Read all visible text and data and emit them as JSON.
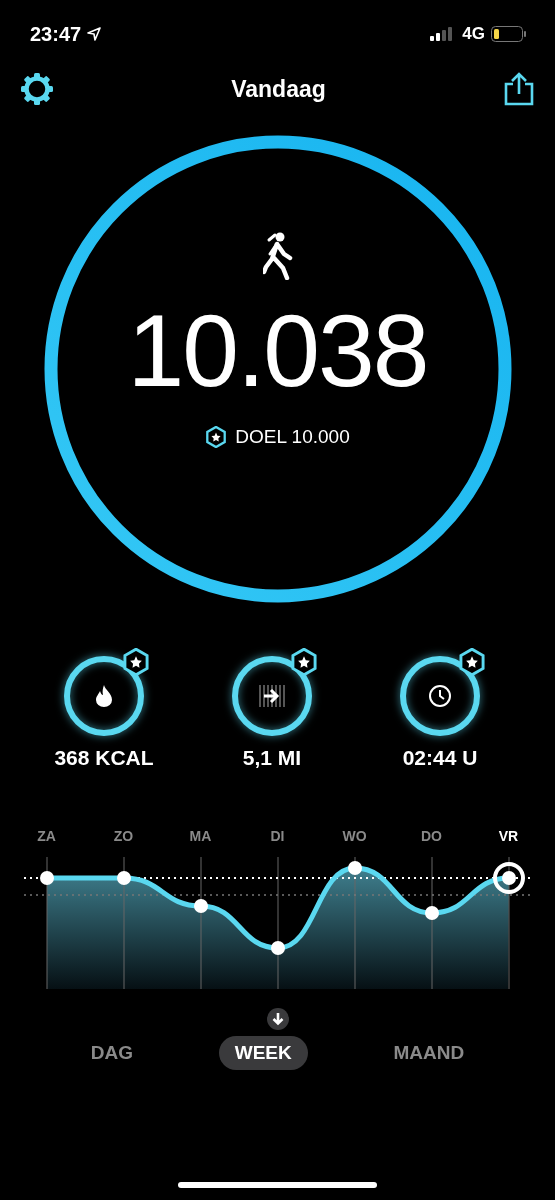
{
  "status_bar": {
    "time": "23:47",
    "network": "4G"
  },
  "nav": {
    "title": "Vandaag"
  },
  "steps": {
    "value": "10.038",
    "goal": "DOEL 10.000",
    "level": 1
  },
  "stats": [
    {
      "kind": "calories",
      "value": "368 KCAL",
      "level": 1
    },
    {
      "kind": "distance",
      "value": "5,1 MI",
      "level": 1
    },
    {
      "kind": "duration",
      "value": "02:44 U",
      "level": 1
    }
  ],
  "days": [
    {
      "label": "ZA",
      "selected": false
    },
    {
      "label": "ZO",
      "selected": false
    },
    {
      "label": "MA",
      "selected": false
    },
    {
      "label": "DI",
      "selected": false
    },
    {
      "label": "WO",
      "selected": false
    },
    {
      "label": "DO",
      "selected": false
    },
    {
      "label": "VR",
      "selected": true
    }
  ],
  "period_tabs": [
    {
      "label": "DAG",
      "selected": false
    },
    {
      "label": "WEEK",
      "selected": true
    },
    {
      "label": "MAAND",
      "selected": false
    }
  ]
}
